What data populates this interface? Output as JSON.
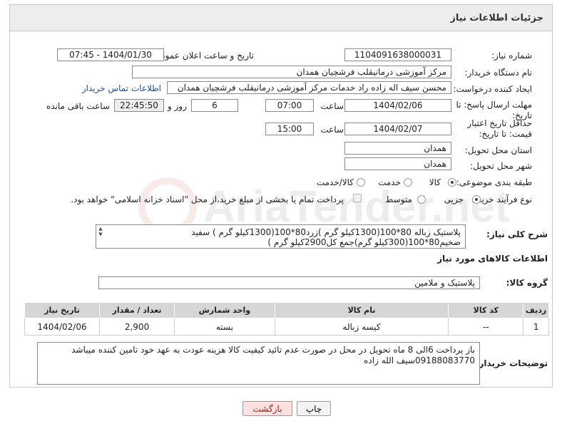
{
  "header": {
    "title": "جزئیات اطلاعات نیاز"
  },
  "watermark": {
    "text": "AriaTender.net"
  },
  "form": {
    "need_number_label": "شماره نیاز:",
    "need_number": "1104091638000031",
    "announce_label": "تاریخ و ساعت اعلان عمومی:",
    "announce_value": "1404/01/30 - 07:45",
    "buyer_label": "نام دستگاه خریدار:",
    "buyer_value": "مرکز آموزشی درمانیقلب فرشچیان همدان",
    "creator_label": "ایجاد کننده درخواست:",
    "creator_value": "محسن سیف اله زاده راد خدمات مرکز آموزشی درمانیقلب فرشچیان همدان",
    "contact_link": "اطلاعات تماس خریدار",
    "deadline_label": "مهلت ارسال پاسخ: تا تاریخ:",
    "deadline_date": "1404/02/06",
    "time_label": "ساعت",
    "deadline_time": "07:00",
    "days_value": "6",
    "days_label": "روز و",
    "remaining_time": "22:45:50",
    "remaining_label": "ساعت باقی مانده",
    "validity_label": "حداقل تاریخ اعتبار قیمت: تا تاریخ:",
    "validity_date": "1404/02/07",
    "validity_time_label": "ساعت",
    "validity_time": "15:00",
    "province_label": "استان محل تحویل:",
    "province_value": "همدان",
    "city_label": "شهر محل تحویل:",
    "city_value": "همدان",
    "category_label": "طبقه بندی موضوعی:",
    "category_options": [
      "کالا",
      "خدمت",
      "کالا/خدمت"
    ],
    "category_selected": "کالا",
    "process_label": "نوع فرآیند خرید :",
    "process_options": [
      "جزیی",
      "متوسط"
    ],
    "process_selected": "جزیی",
    "payment_note": "پرداخت تمام یا بخشی از مبلغ خرید،از محل \"اسناد خزانه اسلامی\" خواهد بود."
  },
  "description": {
    "label": "شرح کلی نیاز:",
    "text": "پلاستیک زباله 80*100(1300کیلو گرم )زرد80*100(1300کیلو گرم ) سفید ضخیم80*100(300کیلو گرم)جمع کل2900کیلو گرم )"
  },
  "goods": {
    "section_title": "اطلاعات کالاهای مورد نیاز",
    "group_label": "گروه کالا:",
    "group_value": "پلاستیک و ملامین",
    "columns": [
      "ردیف",
      "کد کالا",
      "نام کالا",
      "واحد شمارش",
      "تعداد / مقدار",
      "تاریخ نیاز"
    ],
    "rows": [
      {
        "row": "1",
        "code": "--",
        "name": "کیسه زباله",
        "unit": "بسته",
        "qty": "2,900",
        "date": "1404/02/06"
      }
    ]
  },
  "notes": {
    "label": "توضیحات خریدار:",
    "text": "باز پرداخت 6الی 8 ماه تحویل در محل در صورت عدم تائید کیفیت کالا هزینه عودت به عهد خود تامین کننده میباشد 09188083770سیف الله زاده"
  },
  "buttons": {
    "print": "چاپ",
    "back": "بازگشت"
  }
}
